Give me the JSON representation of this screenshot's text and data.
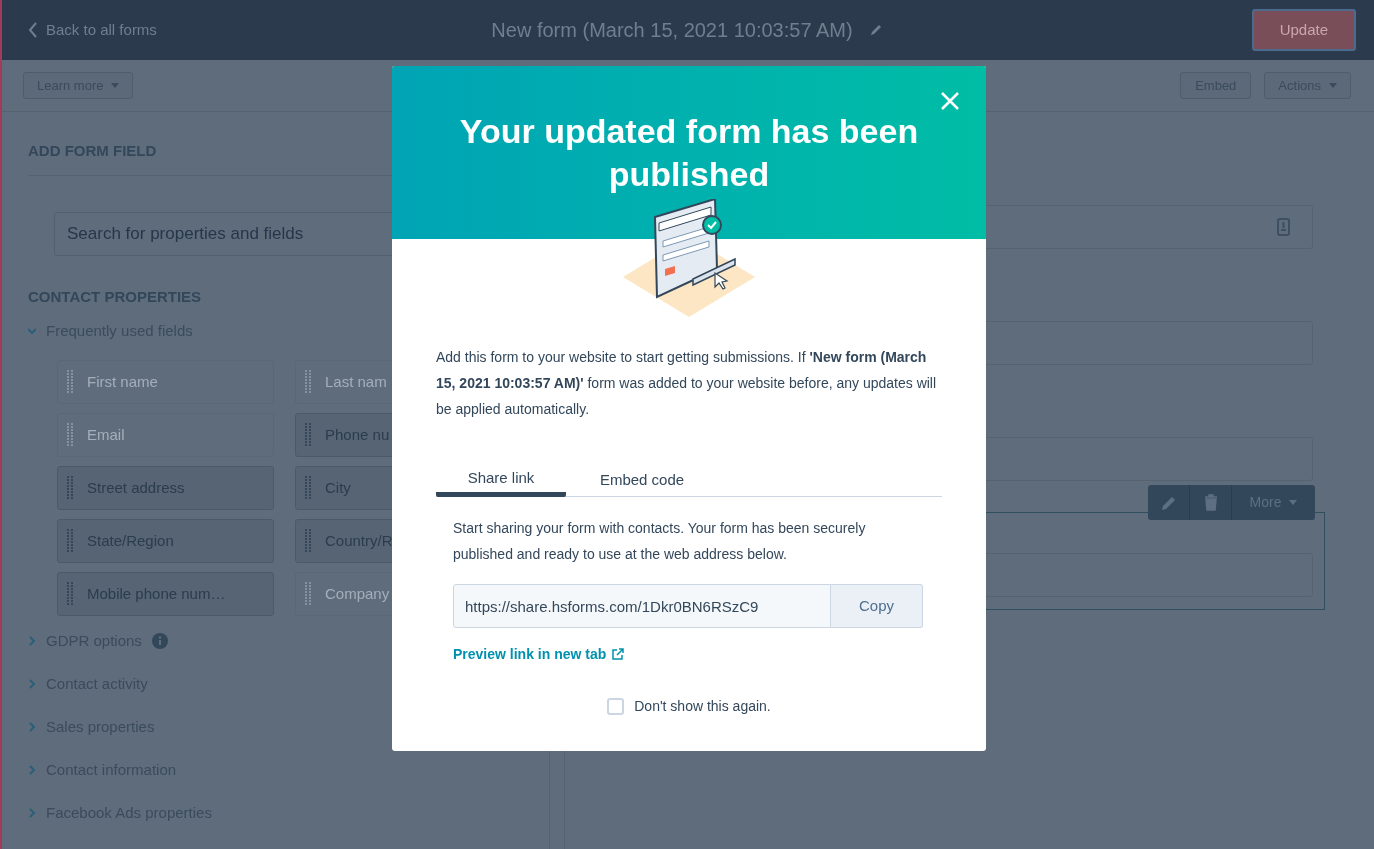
{
  "header": {
    "back_link": "Back to all forms",
    "title": "New form (March 15, 2021 10:03:57 AM)",
    "update_button": "Update"
  },
  "toolbar": {
    "learn_more": "Learn more",
    "embed": "Embed",
    "actions": "Actions"
  },
  "sidebar": {
    "heading": "ADD FORM FIELD",
    "search": {
      "placeholder": "Search for properties and fields"
    },
    "section_heading": "CONTACT PROPERTIES",
    "groups": [
      {
        "label": "Frequently used fields",
        "expanded": true,
        "info": false,
        "fields": [
          {
            "label": "First name",
            "disabled": true
          },
          {
            "label": "Last nam",
            "disabled": true
          },
          {
            "label": "Email",
            "disabled": true
          },
          {
            "label": "Phone nu",
            "disabled": false
          },
          {
            "label": "Street address",
            "disabled": false
          },
          {
            "label": "City",
            "disabled": false
          },
          {
            "label": "State/Region",
            "disabled": false
          },
          {
            "label": "Country/R",
            "disabled": false
          },
          {
            "label": "Mobile phone num…",
            "disabled": false
          },
          {
            "label": "Company",
            "disabled": true
          }
        ]
      },
      {
        "label": "GDPR options",
        "expanded": false,
        "info": true
      },
      {
        "label": "Contact activity",
        "expanded": false,
        "info": false
      },
      {
        "label": "Sales properties",
        "expanded": false,
        "info": false
      },
      {
        "label": "Contact information",
        "expanded": false,
        "info": false
      },
      {
        "label": "Facebook Ads properties",
        "expanded": false,
        "info": false
      }
    ]
  },
  "preview": {
    "field_toolbar": {
      "more": "More"
    }
  },
  "modal": {
    "title": "Your updated form has been published",
    "message": "Add this form to your website to start getting submissions. If **'New form (March 15, 2021 10:03:57 AM)'** form was added to your website before, any updates will be applied automatically.",
    "tabs": [
      {
        "label": "Share link",
        "selected": true
      },
      {
        "label": "Embed code",
        "selected": false
      }
    ],
    "description": "Start sharing your form with contacts. Your form has been securely published and ready to use at the web address below.",
    "url": "https://share.hsforms.com/1Dkr0BN6RSzC9",
    "copy_button": "Copy",
    "preview_link": "Preview link in new tab",
    "dont_show": {
      "label": "Don't show this again.",
      "checked": false
    }
  }
}
